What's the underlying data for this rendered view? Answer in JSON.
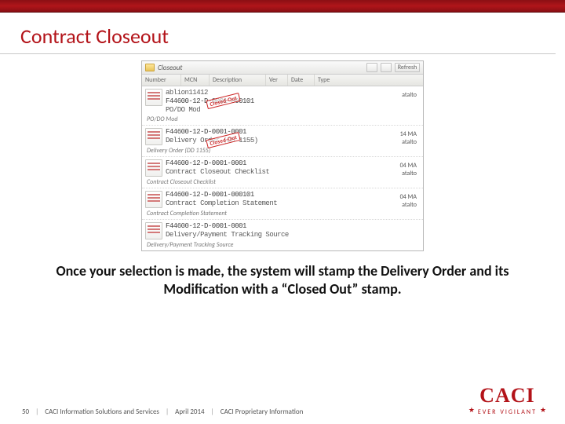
{
  "title": "Contract Closeout",
  "caption": "Once your selection is made, the system will stamp the Delivery Order and its Modification with a “Closed Out” stamp.",
  "footer": {
    "page": "50",
    "org": "CACI Information Solutions and Services",
    "date": "April 2014",
    "classification": "CACI Proprietary Information"
  },
  "logo": {
    "text": "CACI",
    "tagline": "EVER VIGILANT"
  },
  "window": {
    "breadcrumb": "Closeout",
    "refresh_label": "Refresh",
    "columns": [
      "Number",
      "MCN",
      "Description",
      "Ver",
      "Date",
      "Type"
    ],
    "stamp_text": "Closed-Out",
    "items": [
      {
        "top": "ablion11412",
        "id": "F44600-12-D-0001-000101",
        "sub": "PO/DO Mod",
        "group_label": "PO/DO Mod",
        "stamped": true,
        "right1": "atalto",
        "right2": ""
      },
      {
        "top": "",
        "id": "F44600-12-D-0001-0001",
        "sub": "Delivery Order (DD 1155)",
        "group_label": "Delivery Order (DD 1155)",
        "stamped": true,
        "right1": "14 MA",
        "right2": "atalto"
      },
      {
        "top": "",
        "id": "F44600-12-D-0001-0001",
        "sub": "Contract Closeout Checklist",
        "group_label": "Contract Closeout Checklist",
        "stamped": false,
        "right1": "04 MA",
        "right2": "atalto"
      },
      {
        "top": "",
        "id": "F44600-12-D-0001-000101",
        "sub": "Contract Completion Statement",
        "group_label": "Contract Completion Statement",
        "stamped": false,
        "right1": "04 MA",
        "right2": "atalto"
      },
      {
        "top": "",
        "id": "F44600-12-D-0001-0001",
        "sub": "Delivery/Payment Tracking Source",
        "group_label": "Delivery/Payment Tracking Source",
        "stamped": false,
        "right1": "",
        "right2": ""
      }
    ]
  }
}
